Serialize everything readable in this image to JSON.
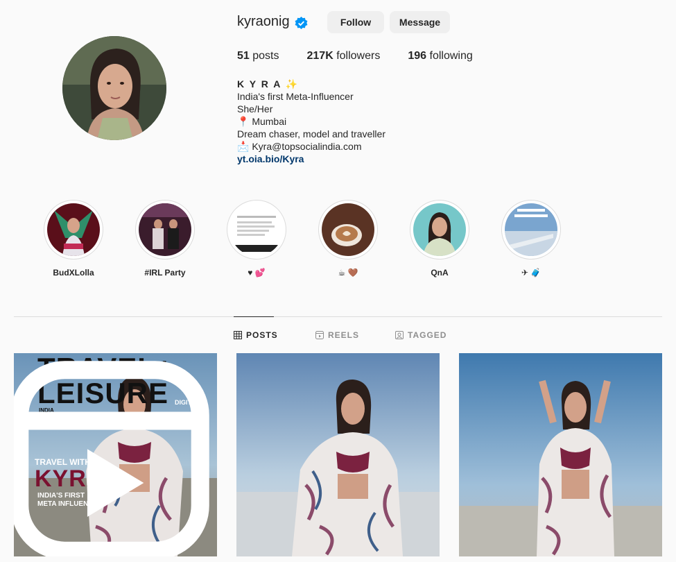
{
  "profile": {
    "username": "kyraonig",
    "follow_label": "Follow",
    "message_label": "Message",
    "stats": {
      "posts_count": "51",
      "posts_label": "posts",
      "followers_count": "217K",
      "followers_label": "followers",
      "following_count": "196",
      "following_label": "following"
    },
    "bio": {
      "name": "K Y R A ✨",
      "line1": "India's first Meta-Influencer",
      "line2": "She/Her",
      "location": "📍  Mumbai",
      "line4": "Dream chaser, model and traveller",
      "email": "📩 Kyra@topsocialindia.com",
      "link": "yt.oia.bio/Kyra"
    }
  },
  "highlights": [
    {
      "label": "BudXLolla",
      "icon": "highlight-budxlolla"
    },
    {
      "label": "#IRL Party",
      "icon": "highlight-irl-party"
    },
    {
      "label": "♥ 💕",
      "icon": "highlight-hearts"
    },
    {
      "label": "☕ 🤎",
      "icon": "highlight-coffee"
    },
    {
      "label": "QnA",
      "icon": "highlight-qna"
    },
    {
      "label": "✈ 🧳",
      "icon": "highlight-travel"
    }
  ],
  "tabs": [
    {
      "label": "POSTS",
      "icon": "grid-icon",
      "active": true
    },
    {
      "label": "REELS",
      "icon": "reels-icon",
      "active": false
    },
    {
      "label": "TAGGED",
      "icon": "tagged-icon",
      "active": false
    }
  ],
  "posts": {
    "cover_title_line1": "TRAVEL+",
    "cover_title_line2": "LEISURE",
    "cover_india": "INDIA",
    "cover_digital": "DIGITAL",
    "cover_travel_with": "TRAVEL WITH",
    "cover_kyra": "KYRA",
    "cover_first_line1": "INDIA'S FIRST",
    "cover_first_line2": "META INFLUENCER"
  },
  "colors": {
    "background": "#fafafa",
    "verified": "#0095f6",
    "link": "#00376b",
    "button_bg": "#efefef"
  }
}
